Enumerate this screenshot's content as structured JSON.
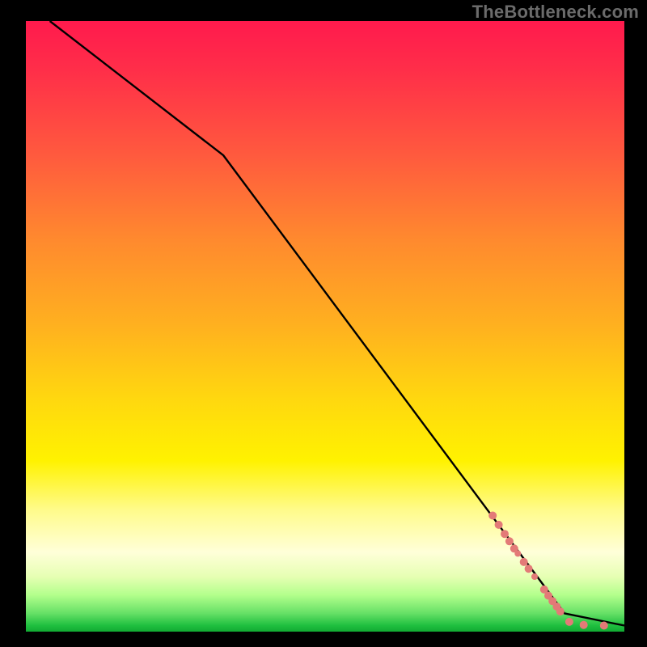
{
  "watermark": "TheBottleneck.com",
  "colors": {
    "background": "#000000",
    "line": "#000000",
    "marker": "#e37a77",
    "watermark_text": "#6b6b6b"
  },
  "chart_data": {
    "type": "line",
    "title": "",
    "xlabel": "",
    "ylabel": "",
    "xlim": [
      0,
      100
    ],
    "ylim": [
      0,
      100
    ],
    "grid": false,
    "legend": false,
    "line_points": [
      {
        "x": 4,
        "y": 100
      },
      {
        "x": 33,
        "y": 78
      },
      {
        "x": 90,
        "y": 3
      },
      {
        "x": 100,
        "y": 1
      }
    ],
    "markers": [
      {
        "x": 78,
        "y": 19,
        "r": 5
      },
      {
        "x": 79,
        "y": 17.5,
        "r": 5
      },
      {
        "x": 80,
        "y": 16,
        "r": 5
      },
      {
        "x": 80.8,
        "y": 14.8,
        "r": 5
      },
      {
        "x": 81.6,
        "y": 13.6,
        "r": 5
      },
      {
        "x": 82.2,
        "y": 12.8,
        "r": 4
      },
      {
        "x": 83.2,
        "y": 11.4,
        "r": 5
      },
      {
        "x": 84,
        "y": 10.3,
        "r": 5
      },
      {
        "x": 85,
        "y": 9,
        "r": 4
      },
      {
        "x": 86.6,
        "y": 6.9,
        "r": 5
      },
      {
        "x": 87.3,
        "y": 5.9,
        "r": 5
      },
      {
        "x": 88,
        "y": 5,
        "r": 5
      },
      {
        "x": 88.7,
        "y": 4.1,
        "r": 5
      },
      {
        "x": 89.3,
        "y": 3.3,
        "r": 5
      },
      {
        "x": 90.8,
        "y": 1.6,
        "r": 5
      },
      {
        "x": 93.2,
        "y": 1.1,
        "r": 5
      },
      {
        "x": 96.6,
        "y": 1.0,
        "r": 5
      }
    ]
  }
}
